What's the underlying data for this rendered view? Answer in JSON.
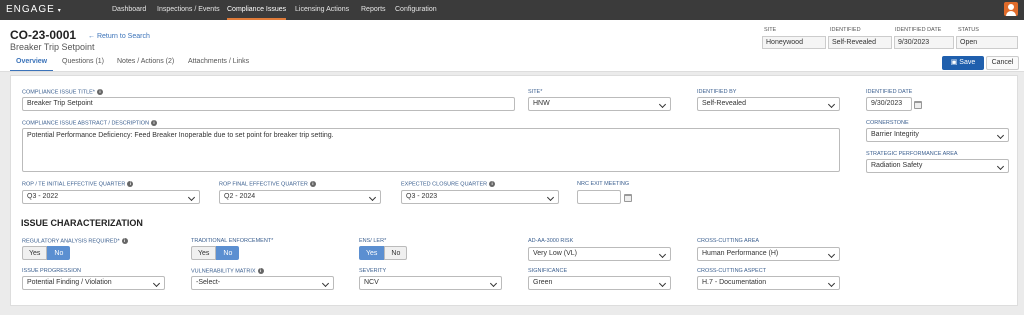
{
  "nav": {
    "logo": "ENGAGE",
    "items": [
      "Dashboard",
      "Inspections / Events",
      "Compliance Issues",
      "Licensing Actions",
      "Reports",
      "Configuration"
    ],
    "active": "Compliance Issues"
  },
  "record": {
    "id": "CO-23-0001",
    "title": "Breaker Trip Setpoint",
    "return_link": "← Return to Search"
  },
  "meta": {
    "site_label": "SITE",
    "site_value": "Honeywood",
    "identified_label": "IDENTIFIED",
    "identified_value": "Self-Revealed",
    "identified_date_label": "IDENTIFIED DATE",
    "identified_date_value": "9/30/2023",
    "status_label": "STATUS",
    "status_value": "Open"
  },
  "tabs": [
    "Overview",
    "Questions (1)",
    "Notes / Actions (2)",
    "Attachments / Links"
  ],
  "buttons": {
    "save": "Save",
    "cancel": "Cancel"
  },
  "form": {
    "title_label": "COMPLIANCE ISSUE TITLE*",
    "title_value": "Breaker Trip Setpoint",
    "abstract_label": "COMPLIANCE ISSUE ABSTRACT / DESCRIPTION",
    "abstract_value": "Potential Performance Deficiency: Feed Breaker Inoperable due to set point for breaker trip setting.",
    "site_label": "SITE*",
    "site_value": "HNW",
    "identified_by_label": "IDENTIFIED BY",
    "identified_by_value": "Self-Revealed",
    "identified_date_label": "IDENTIFIED DATE",
    "identified_date_value": "9/30/2023",
    "cornerstone_label": "CORNERSTONE",
    "cornerstone_value": "Barrier Integrity",
    "strategic_label": "STRATEGIC PERFORMANCE AREA",
    "strategic_value": "Radiation Safety",
    "rop_initial_label": "ROP / TE INITIAL EFFECTIVE QUARTER",
    "rop_initial_value": "Q3 - 2022",
    "rop_final_label": "ROP FINAL EFFECTIVE QUARTER",
    "rop_final_value": "Q2 - 2024",
    "expected_label": "EXPECTED CLOSURE QUARTER",
    "expected_value": "Q3 - 2023",
    "nrc_label": "NRC EXIT MEETING",
    "nrc_value": ""
  },
  "issue": {
    "section_title": "ISSUE CHARACTERIZATION",
    "regulatory_label": "REGULATORY ANALYSIS REQUIRED*",
    "traditional_label": "TRADITIONAL ENFORCEMENT*",
    "ens_label": "ENS/ LER*",
    "yes": "Yes",
    "no": "No",
    "regulatory_selected": "No",
    "traditional_selected": "No",
    "ens_selected": "Yes",
    "ad_label": "AD-AA-3000 RISK",
    "ad_value": "Very Low (VL)",
    "cc_area_label": "CROSS-CUTTING AREA",
    "cc_area_value": "Human Performance (H)",
    "progression_label": "ISSUE PROGRESSION",
    "progression_value": "Potential Finding / Violation",
    "vulnerability_label": "VULNERABILITY MATRIX",
    "vulnerability_value": "-Select-",
    "severity_label": "SEVERITY",
    "severity_value": "NCV",
    "significance_label": "SIGNIFICANCE",
    "significance_value": "Green",
    "cc_aspect_label": "CROSS-CUTTING ASPECT",
    "cc_aspect_value": "H.7 - Documentation"
  }
}
